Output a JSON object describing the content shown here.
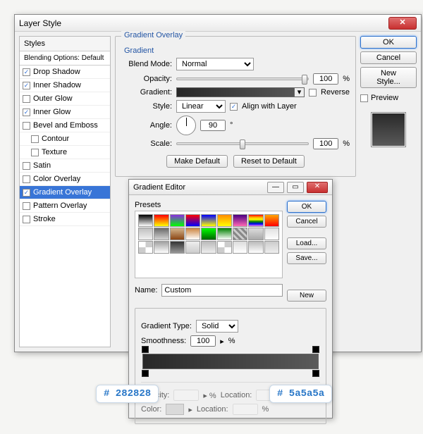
{
  "dialog": {
    "title": "Layer Style",
    "styles_header": "Styles",
    "blending_label": "Blending Options: Default",
    "items": [
      {
        "label": "Drop Shadow",
        "checked": true
      },
      {
        "label": "Inner Shadow",
        "checked": true
      },
      {
        "label": "Outer Glow",
        "checked": false
      },
      {
        "label": "Inner Glow",
        "checked": true
      },
      {
        "label": "Bevel and Emboss",
        "checked": false
      },
      {
        "label": "Contour",
        "checked": false,
        "sub": true
      },
      {
        "label": "Texture",
        "checked": false,
        "sub": true
      },
      {
        "label": "Satin",
        "checked": false
      },
      {
        "label": "Color Overlay",
        "checked": false
      },
      {
        "label": "Gradient Overlay",
        "checked": true,
        "selected": true
      },
      {
        "label": "Pattern Overlay",
        "checked": false
      },
      {
        "label": "Stroke",
        "checked": false
      }
    ],
    "buttons": {
      "ok": "OK",
      "cancel": "Cancel",
      "new_style": "New Style...",
      "preview": "Preview"
    }
  },
  "overlay": {
    "group_title": "Gradient Overlay",
    "sub_title": "Gradient",
    "blend_label": "Blend Mode:",
    "blend_value": "Normal",
    "opacity_label": "Opacity:",
    "opacity_value": "100",
    "pct": "%",
    "gradient_label": "Gradient:",
    "reverse_label": "Reverse",
    "style_label": "Style:",
    "style_value": "Linear",
    "align_label": "Align with Layer",
    "angle_label": "Angle:",
    "angle_value": "90",
    "deg": "°",
    "scale_label": "Scale:",
    "scale_value": "100",
    "make_default": "Make Default",
    "reset_default": "Reset to Default"
  },
  "editor": {
    "title": "Gradient Editor",
    "presets_label": "Presets",
    "ok": "OK",
    "cancel": "Cancel",
    "load": "Load...",
    "save": "Save...",
    "name_label": "Name:",
    "name_value": "Custom",
    "new": "New",
    "type_label": "Gradient Type:",
    "type_value": "Solid",
    "smooth_label": "Smoothness:",
    "smooth_value": "100",
    "pct": "%",
    "opacity_stop": "Opacity:",
    "location": "Location:",
    "color_stop": "Color:",
    "preset_colors": [
      "linear-gradient(#000,#fff)",
      "linear-gradient(#ff0000,#ffff00)",
      "linear-gradient(#8a2be2,#00ff00)",
      "linear-gradient(#ff0000,#0000ff)",
      "linear-gradient(#0000ff,#ffff00)",
      "linear-gradient(#ff8c00,#ffff00)",
      "linear-gradient(#4b0082,#ff69b4)",
      "linear-gradient(red,orange,yellow,green,blue,violet)",
      "linear-gradient(#ffa500,#ff0000)",
      "linear-gradient(#c0c0c0,#f0f0f0)",
      "linear-gradient(#696969,#d3d3d3)",
      "linear-gradient(#d2b48c,#8b4513)",
      "linear-gradient(#cd853f,#fff)",
      "linear-gradient(#00ff00,#006400)",
      "linear-gradient(#008000,#fff)",
      "repeating-linear-gradient(45deg,#888 0 3px,#ccc 3px 6px)",
      "linear-gradient(#dcdcdc,#a9a9a9)",
      "linear-gradient(#e0e0e0,#fff)",
      "repeating-conic-gradient(#ccc 0 25%,#fff 0 50%)",
      "linear-gradient(#a0a0a0,#fff)",
      "linear-gradient(#333,#999)",
      "linear-gradient(#eee,#ccc)",
      "linear-gradient(#bbb,#eee)",
      "repeating-conic-gradient(#ccc 0 25%,#fff 0 50%)",
      "linear-gradient(#ddd,#fff)",
      "linear-gradient(#bbb,#fff)",
      "linear-gradient(#ccc,#eee)"
    ]
  },
  "callouts": {
    "left": "# 282828",
    "right": "# 5a5a5a"
  }
}
